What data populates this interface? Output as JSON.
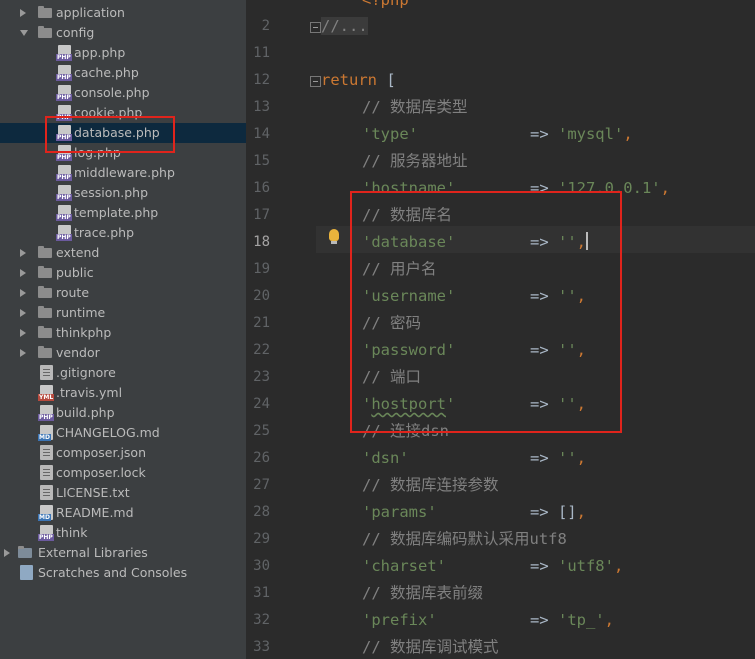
{
  "tree": {
    "items": [
      {
        "label": "application",
        "kind": "folder",
        "indent": 0,
        "arrow": "right",
        "icon": "folder-icon"
      },
      {
        "label": "config",
        "kind": "folder",
        "indent": 0,
        "arrow": "down",
        "icon": "folder-icon"
      },
      {
        "label": "app.php",
        "kind": "php",
        "indent": 1,
        "icon": "php-file-icon"
      },
      {
        "label": "cache.php",
        "kind": "php",
        "indent": 1,
        "icon": "php-file-icon"
      },
      {
        "label": "console.php",
        "kind": "php",
        "indent": 1,
        "icon": "php-file-icon"
      },
      {
        "label": "cookie.php",
        "kind": "php",
        "indent": 1,
        "icon": "php-file-icon"
      },
      {
        "label": "database.php",
        "kind": "php",
        "indent": 1,
        "icon": "php-file-icon",
        "selected": true
      },
      {
        "label": "log.php",
        "kind": "php",
        "indent": 1,
        "icon": "php-file-icon"
      },
      {
        "label": "middleware.php",
        "kind": "php",
        "indent": 1,
        "icon": "php-file-icon"
      },
      {
        "label": "session.php",
        "kind": "php",
        "indent": 1,
        "icon": "php-file-icon"
      },
      {
        "label": "template.php",
        "kind": "php",
        "indent": 1,
        "icon": "php-file-icon"
      },
      {
        "label": "trace.php",
        "kind": "php",
        "indent": 1,
        "icon": "php-file-icon"
      },
      {
        "label": "extend",
        "kind": "folder",
        "indent": 0,
        "arrow": "right",
        "icon": "folder-icon"
      },
      {
        "label": "public",
        "kind": "folder",
        "indent": 0,
        "arrow": "right",
        "icon": "folder-icon"
      },
      {
        "label": "route",
        "kind": "folder",
        "indent": 0,
        "arrow": "right",
        "icon": "folder-icon"
      },
      {
        "label": "runtime",
        "kind": "folder",
        "indent": 0,
        "arrow": "right",
        "icon": "folder-icon"
      },
      {
        "label": "thinkphp",
        "kind": "folder",
        "indent": 0,
        "arrow": "right",
        "icon": "folder-icon"
      },
      {
        "label": "vendor",
        "kind": "folder",
        "indent": 0,
        "arrow": "right",
        "icon": "folder-icon"
      },
      {
        "label": ".gitignore",
        "kind": "text",
        "indent": 0,
        "icon": "gitignore-file-icon"
      },
      {
        "label": ".travis.yml",
        "kind": "yml",
        "indent": 0,
        "icon": "yml-file-icon"
      },
      {
        "label": "build.php",
        "kind": "php",
        "indent": 0,
        "icon": "php-file-icon"
      },
      {
        "label": "CHANGELOG.md",
        "kind": "md",
        "indent": 0,
        "icon": "md-file-icon"
      },
      {
        "label": "composer.json",
        "kind": "text",
        "indent": 0,
        "icon": "json-file-icon"
      },
      {
        "label": "composer.lock",
        "kind": "text",
        "indent": 0,
        "icon": "lock-file-icon"
      },
      {
        "label": "LICENSE.txt",
        "kind": "text",
        "indent": 0,
        "icon": "txt-file-icon"
      },
      {
        "label": "README.md",
        "kind": "md",
        "indent": 0,
        "icon": "md-file-icon"
      },
      {
        "label": "think",
        "kind": "php",
        "indent": 0,
        "icon": "php-file-icon"
      },
      {
        "label": "External Libraries",
        "kind": "libs",
        "indent": -1,
        "arrow": "right",
        "icon": "libraries-icon"
      },
      {
        "label": "Scratches and Consoles",
        "kind": "scratch",
        "indent": -1,
        "icon": "scratches-icon"
      }
    ],
    "badges": {
      "php": "PHP",
      "yml": "YML",
      "md": "MD"
    }
  },
  "editor": {
    "current_line": "18",
    "lines": [
      {
        "num": "",
        "tokens": [
          {
            "cls": "k",
            "text": "<?php"
          }
        ]
      },
      {
        "num": "2",
        "fold": true,
        "tokens": [
          {
            "cls": "c folded-box",
            "text": "//..."
          }
        ],
        "x": 0
      },
      {
        "num": "11",
        "tokens": []
      },
      {
        "num": "12",
        "fold": true,
        "tokens": [
          {
            "cls": "k",
            "text": "return "
          },
          {
            "cls": "t",
            "text": "["
          }
        ],
        "x": 0
      },
      {
        "num": "13",
        "tokens": [
          {
            "cls": "c",
            "text": "// 数据库类型"
          }
        ]
      },
      {
        "num": "14",
        "tokens": [
          {
            "cls": "s",
            "text": "'type'"
          },
          {
            "cls": "t",
            "text": "            => "
          },
          {
            "cls": "s",
            "text": "'mysql'"
          },
          {
            "cls": "k",
            "text": ","
          }
        ]
      },
      {
        "num": "15",
        "tokens": [
          {
            "cls": "c",
            "text": "// 服务器地址"
          }
        ]
      },
      {
        "num": "16",
        "tokens": [
          {
            "cls": "s",
            "text": "'hostname'"
          },
          {
            "cls": "t",
            "text": "        => "
          },
          {
            "cls": "s",
            "text": "'127.0.0.1'"
          },
          {
            "cls": "k",
            "text": ","
          }
        ]
      },
      {
        "num": "17",
        "tokens": [
          {
            "cls": "c",
            "text": "// 数据库名"
          }
        ]
      },
      {
        "num": "18",
        "tokens": [
          {
            "cls": "s",
            "text": "'database'"
          },
          {
            "cls": "t",
            "text": "        => "
          },
          {
            "cls": "s",
            "text": "''"
          },
          {
            "cls": "k",
            "text": ","
          }
        ],
        "caret": true
      },
      {
        "num": "19",
        "tokens": [
          {
            "cls": "c",
            "text": "// 用户名"
          }
        ]
      },
      {
        "num": "20",
        "tokens": [
          {
            "cls": "s",
            "text": "'username'"
          },
          {
            "cls": "t",
            "text": "        => "
          },
          {
            "cls": "s",
            "text": "''"
          },
          {
            "cls": "k",
            "text": ","
          }
        ]
      },
      {
        "num": "21",
        "tokens": [
          {
            "cls": "c",
            "text": "// 密码"
          }
        ]
      },
      {
        "num": "22",
        "tokens": [
          {
            "cls": "s",
            "text": "'password'"
          },
          {
            "cls": "t",
            "text": "        => "
          },
          {
            "cls": "s",
            "text": "''"
          },
          {
            "cls": "k",
            "text": ","
          }
        ]
      },
      {
        "num": "23",
        "tokens": [
          {
            "cls": "c",
            "text": "// 端口"
          }
        ]
      },
      {
        "num": "24",
        "tokens": [
          {
            "cls": "s",
            "text": "'"
          },
          {
            "cls": "s squiggle",
            "text": "hostport"
          },
          {
            "cls": "s",
            "text": "'"
          },
          {
            "cls": "t",
            "text": "        => "
          },
          {
            "cls": "s",
            "text": "''"
          },
          {
            "cls": "k",
            "text": ","
          }
        ]
      },
      {
        "num": "25",
        "tokens": [
          {
            "cls": "c",
            "text": "// 连接dsn"
          }
        ]
      },
      {
        "num": "26",
        "tokens": [
          {
            "cls": "s",
            "text": "'dsn'"
          },
          {
            "cls": "t",
            "text": "             => "
          },
          {
            "cls": "s",
            "text": "''"
          },
          {
            "cls": "k",
            "text": ","
          }
        ]
      },
      {
        "num": "27",
        "tokens": [
          {
            "cls": "c",
            "text": "// 数据库连接参数"
          }
        ]
      },
      {
        "num": "28",
        "tokens": [
          {
            "cls": "s",
            "text": "'params'"
          },
          {
            "cls": "t",
            "text": "          => []"
          },
          {
            "cls": "k",
            "text": ","
          }
        ]
      },
      {
        "num": "29",
        "tokens": [
          {
            "cls": "c",
            "text": "// 数据库编码默认采用utf8"
          }
        ]
      },
      {
        "num": "30",
        "tokens": [
          {
            "cls": "s",
            "text": "'charset'"
          },
          {
            "cls": "t",
            "text": "         => "
          },
          {
            "cls": "s",
            "text": "'utf8'"
          },
          {
            "cls": "k",
            "text": ","
          }
        ]
      },
      {
        "num": "31",
        "tokens": [
          {
            "cls": "c",
            "text": "// 数据库表前缀"
          }
        ]
      },
      {
        "num": "32",
        "tokens": [
          {
            "cls": "s",
            "text": "'prefix'"
          },
          {
            "cls": "t",
            "text": "          => "
          },
          {
            "cls": "s",
            "text": "'tp_'"
          },
          {
            "cls": "k",
            "text": ","
          }
        ]
      },
      {
        "num": "33",
        "tokens": [
          {
            "cls": "c",
            "text": "// 数据库调试模式"
          }
        ]
      }
    ]
  },
  "colors": {
    "sidebar_bg": "#3c3f41",
    "editor_bg": "#2b2b2b",
    "selection": "#0d293e",
    "annotation_red": "#e0241c",
    "keyword": "#cc7832",
    "string": "#6a8759",
    "comment": "#808080"
  }
}
